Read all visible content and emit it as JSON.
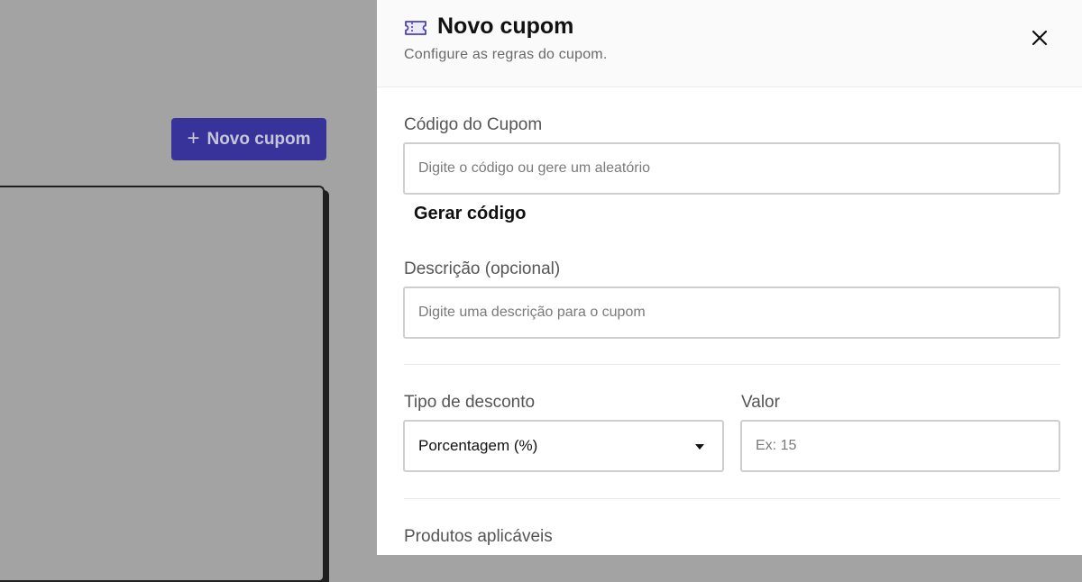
{
  "background": {
    "new_coupon_button": {
      "plus": "+",
      "label": "Novo cupom"
    }
  },
  "drawer": {
    "icon": "ticket-icon",
    "title": "Novo cupom",
    "subtitle": "Configure as regras do cupom.",
    "close_icon": "close-icon",
    "code": {
      "label": "Código do Cupom",
      "placeholder": "Digite o código ou gere um aleatório",
      "value": ""
    },
    "generate_code_label": "Gerar código",
    "description": {
      "label": "Descrição (opcional)",
      "placeholder": "Digite uma descrição para o cupom",
      "value": ""
    },
    "discount_type": {
      "label": "Tipo de desconto",
      "selected": "Porcentagem (%)"
    },
    "value": {
      "label": "Valor",
      "placeholder": "Ex: 15",
      "value": ""
    },
    "products_label": "Produtos aplicáveis"
  },
  "colors": {
    "accent": "#37339a",
    "overlay": "#a3a3a3"
  }
}
